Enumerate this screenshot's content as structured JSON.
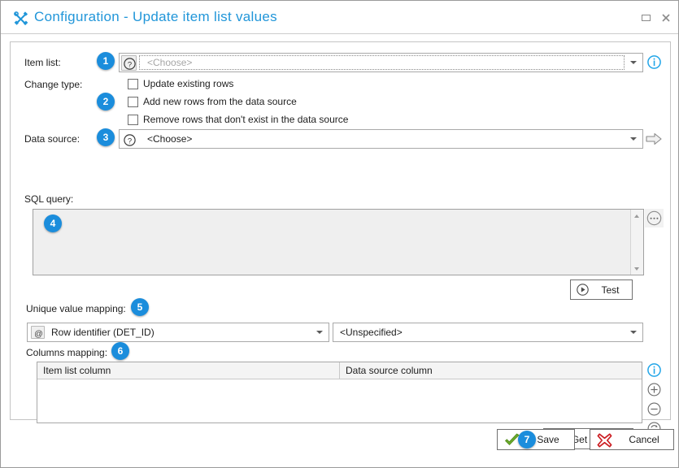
{
  "window": {
    "title": "Configuration - Update item list values",
    "title_icon": "tools-icon",
    "maximize_label": "Maximize",
    "close_label": "Close"
  },
  "form": {
    "item_list": {
      "label": "Item list:",
      "badge": "1",
      "value": "",
      "placeholder": "<Choose>",
      "help_icon": "question-mark-icon",
      "info_icon": "info-icon"
    },
    "change_type": {
      "label": "Change type:",
      "badge": "2",
      "options": [
        {
          "label": "Update existing rows",
          "checked": false
        },
        {
          "label": "Add new rows from the data source",
          "checked": false
        },
        {
          "label": "Remove rows that don't exist in the data source",
          "checked": false
        }
      ]
    },
    "data_source": {
      "label": "Data source:",
      "badge": "3",
      "value": "<Choose>",
      "help_icon": "question-mark-icon",
      "go_icon": "arrow-right-icon"
    },
    "sql_query": {
      "label": "SQL query:",
      "badge": "4",
      "value": "",
      "ellipsis_icon": "ellipsis-icon",
      "scroll_up_icon": "scroll-up-arrow-icon",
      "scroll_down_icon": "scroll-down-arrow-icon"
    },
    "test_button": {
      "label": "Test",
      "icon": "play-circle-icon"
    },
    "unique_value_mapping": {
      "label": "Unique value mapping:",
      "badge": "5",
      "left_value": "Row identifier (DET_ID)",
      "left_icon": "at-sign-icon",
      "right_value": "<Unspecified>"
    },
    "columns_mapping": {
      "label": "Columns mapping:",
      "badge": "6",
      "columns": [
        "Item list column",
        "Data source column"
      ],
      "rows": [],
      "info_icon": "info-icon",
      "add_icon": "plus-circle-icon",
      "remove_icon": "minus-circle-icon",
      "refresh_icon": "refresh-circle-icon"
    },
    "get_columns": {
      "badge": "7",
      "label": "Get columns",
      "icon": "get-columns-icon"
    }
  },
  "footer": {
    "save": {
      "label": "Save",
      "icon": "green-check-icon"
    },
    "cancel": {
      "label": "Cancel",
      "icon": "red-x-icon"
    }
  },
  "colors": {
    "accent": "#2196d9",
    "badge": "#1b8ddc",
    "info": "#21a5e8",
    "save": "#6cab2b",
    "cancel": "#cc1f24"
  }
}
